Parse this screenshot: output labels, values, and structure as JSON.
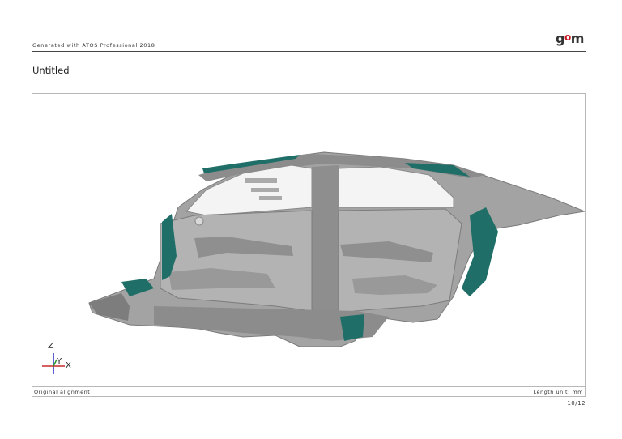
{
  "header": {
    "generator_text": "Generated with ATOS Professional 2018",
    "logo": "gom"
  },
  "report": {
    "title": "Untitled"
  },
  "viewport": {
    "axes": {
      "z": "Z",
      "y": "Y",
      "x": "X"
    },
    "colors": {
      "mesh": "#9a9a9a",
      "mesh_dark": "#6f6f6f",
      "deviation": "#1f6f68"
    }
  },
  "footer": {
    "alignment": "Original alignment",
    "length_unit": "Length unit: mm",
    "page": "10/12"
  }
}
